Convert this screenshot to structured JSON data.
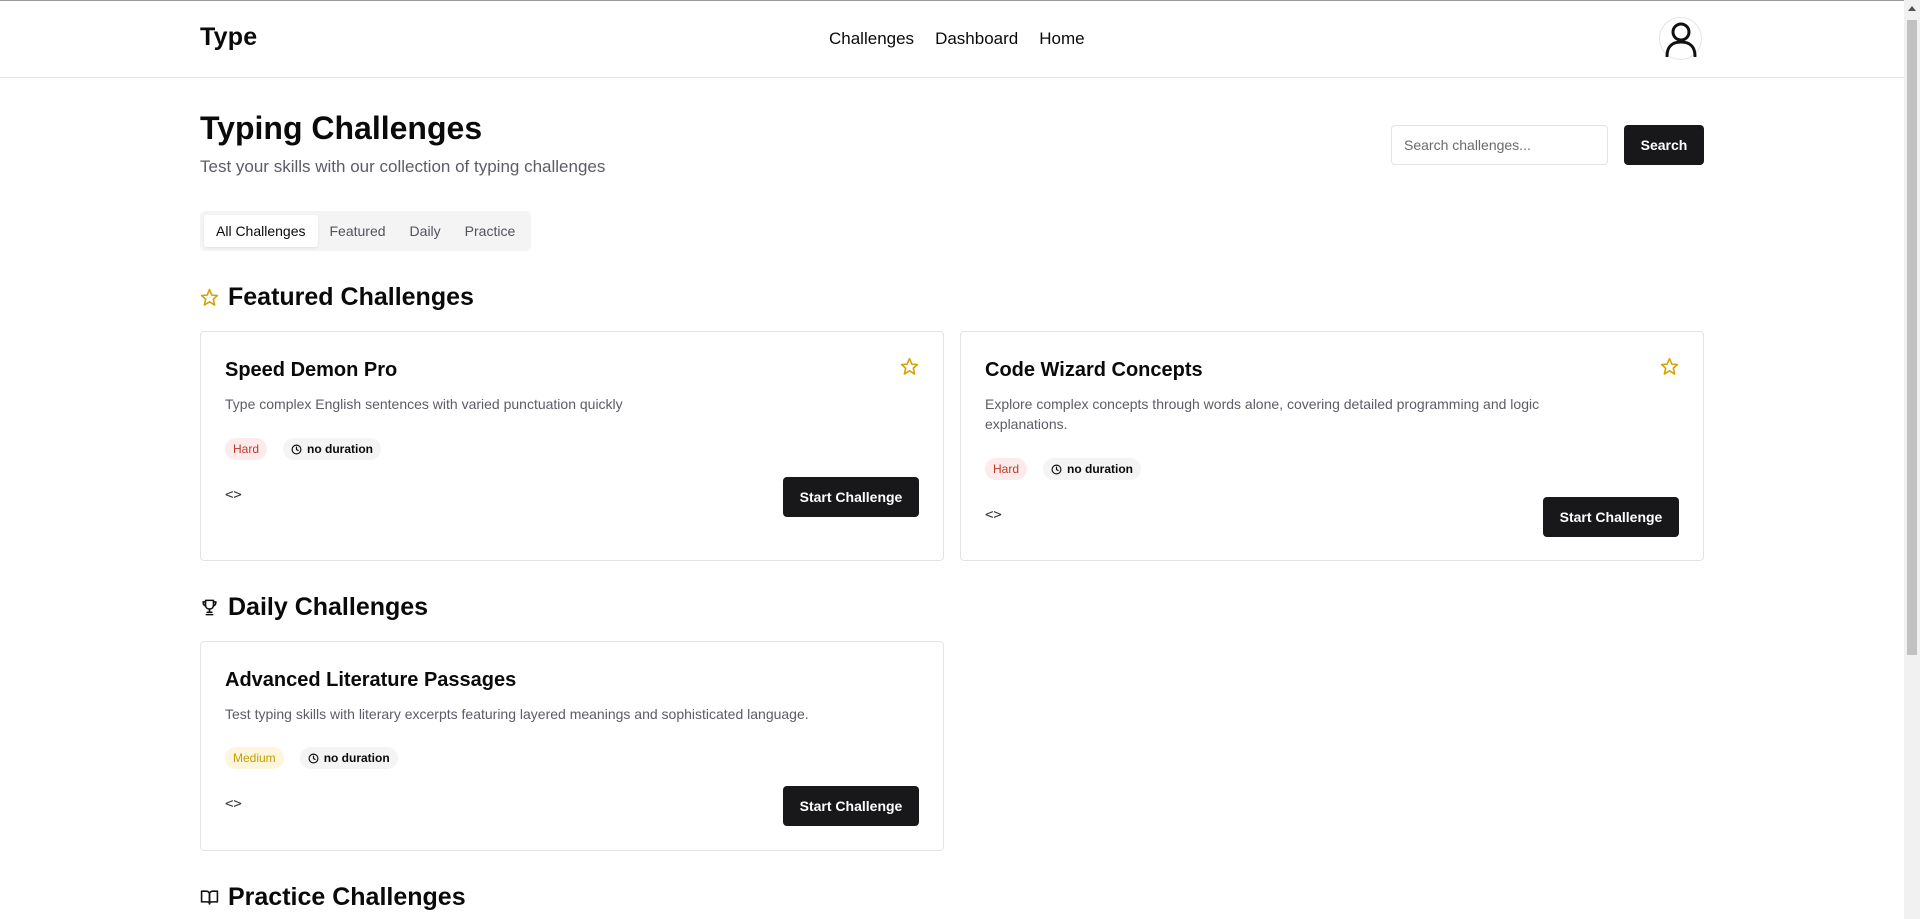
{
  "app": {
    "logo": "Type"
  },
  "nav": {
    "items": [
      "Challenges",
      "Dashboard",
      "Home"
    ]
  },
  "page": {
    "title": "Typing Challenges",
    "subtitle": "Test your skills with our collection of typing challenges"
  },
  "search": {
    "placeholder": "Search challenges...",
    "value": "",
    "button_label": "Search"
  },
  "tabs": [
    {
      "label": "All Challenges",
      "active": true
    },
    {
      "label": "Featured",
      "active": false
    },
    {
      "label": "Daily",
      "active": false
    },
    {
      "label": "Practice",
      "active": false
    }
  ],
  "sections": {
    "featured": {
      "title": "Featured Challenges",
      "icon": "star-icon",
      "cards": [
        {
          "title": "Speed Demon Pro",
          "description": "Type complex English sentences with varied punctuation quickly",
          "difficulty": "Hard",
          "duration": "no duration",
          "button_label": "Start Challenge"
        },
        {
          "title": "Code Wizard Concepts",
          "description": "Explore complex concepts through words alone, covering detailed programming and logic explanations.",
          "difficulty": "Hard",
          "duration": "no duration",
          "button_label": "Start Challenge"
        }
      ]
    },
    "daily": {
      "title": "Daily Challenges",
      "icon": "trophy-icon",
      "cards": [
        {
          "title": "Advanced Literature Passages",
          "description": "Test typing skills with literary excerpts featuring layered meanings and sophisticated language.",
          "difficulty": "Medium",
          "duration": "no duration",
          "button_label": "Start Challenge"
        }
      ]
    },
    "practice": {
      "title": "Practice Challenges",
      "icon": "book-open-icon"
    }
  },
  "colors": {
    "primary": "#18181b",
    "star": "#d4a300",
    "hard_text": "#c0392b",
    "hard_bg": "#fdeaea",
    "medium_text": "#c89b00",
    "medium_bg": "#fdf6dc"
  }
}
